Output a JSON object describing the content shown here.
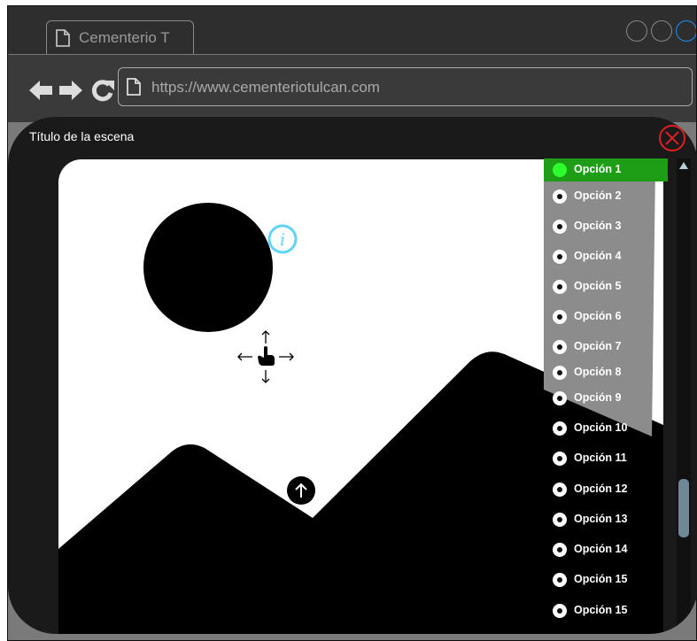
{
  "browser": {
    "tab_title": "Cementerio T",
    "address": "https://www.cementeriotulcan.com",
    "window_buttons": [
      {
        "name": "window-button-1",
        "color": "#888888"
      },
      {
        "name": "window-button-2",
        "color": "#888888"
      },
      {
        "name": "window-button-3",
        "color": "#1e90ff"
      }
    ],
    "icons": {
      "tab": "page-icon",
      "back": "arrow-left-icon",
      "forward": "arrow-right-icon",
      "reload": "reload-icon",
      "address": "page-icon"
    }
  },
  "modal": {
    "title": "Título de la escena",
    "close_icon": "close-icon",
    "close_color": "#e02020",
    "info_icon": "info-icon",
    "info_color": "#5fd4ff",
    "up_icon": "arrow-up-icon",
    "pointer_icon": "hand-move-icon"
  },
  "options": {
    "selected": 0,
    "active_color": "#1d9e16",
    "items": [
      "Opción 1",
      "Opción 2",
      "Opción 3",
      "Opción 4",
      "Opción 5",
      "Opción 6",
      "Opción 7",
      "Opción 8",
      "Opción 9",
      "Opción 10",
      "Opción 11",
      "Opción 12",
      "Opción 13",
      "Opción 14",
      "Opción 15",
      "Opción 15"
    ]
  },
  "scrollbar": {
    "thumb_color": "#6f8796"
  }
}
